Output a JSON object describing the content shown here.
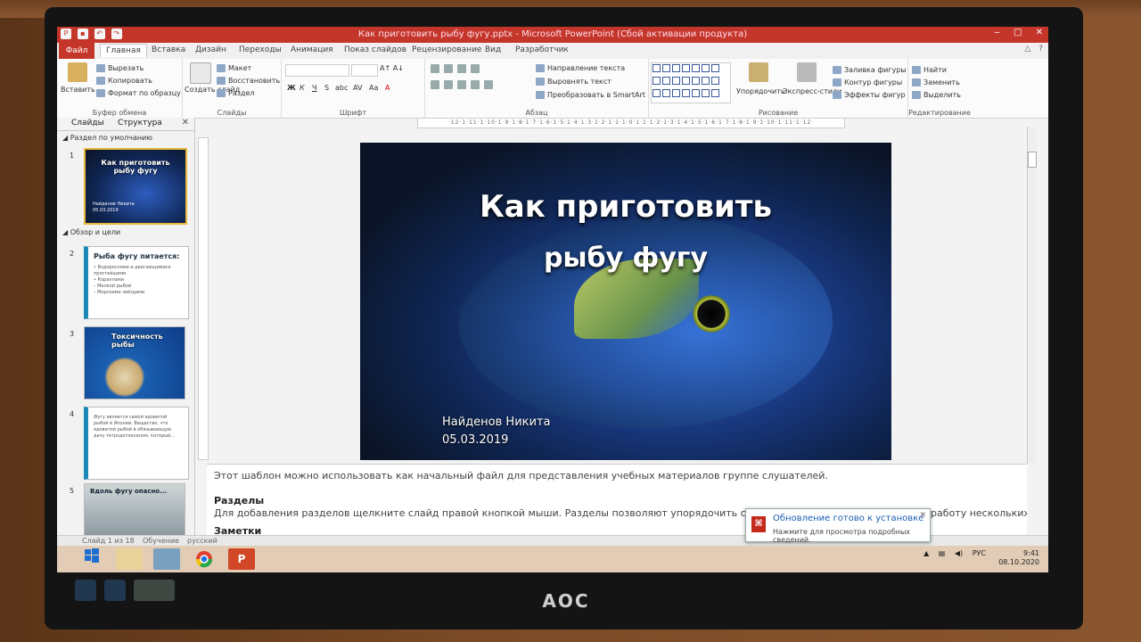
{
  "window": {
    "title": "Как приготовить рыбу фугу.pptx - Microsoft PowerPoint (Сбой активации продукта)",
    "controls": [
      "‒",
      "□",
      "✕"
    ]
  },
  "tabs": [
    "Файл",
    "Главная",
    "Вставка",
    "Дизайн",
    "Переходы",
    "Анимация",
    "Показ слайдов",
    "Рецензирование",
    "Вид",
    "Разработчик"
  ],
  "ribbon": {
    "clipboard": {
      "label": "Буфер обмена",
      "paste": "Вставить",
      "cut": "Вырезать",
      "copy": "Копировать",
      "format_painter": "Формат по образцу"
    },
    "slides": {
      "label": "Слайды",
      "new_slide": "Создать слайд",
      "layout": "Макет",
      "reset": "Восстановить",
      "section": "Раздел"
    },
    "font": {
      "label": "Шрифт",
      "bold": "Ж",
      "italic": "К",
      "underline": "Ч",
      "strike": "S",
      "shadow": "abc",
      "spacing": "AV",
      "case": "Aa",
      "color": "A"
    },
    "paragraph": {
      "label": "Абзац",
      "text_direction": "Направление текста",
      "align_text": "Выровнять текст",
      "smartart": "Преобразовать в SmartArt"
    },
    "drawing": {
      "label": "Рисование",
      "arrange": "Упорядочить",
      "quick_styles": "Экспресс-стили",
      "shape_fill": "Заливка фигуры",
      "shape_outline": "Контур фигуры",
      "shape_effects": "Эффекты фигур"
    },
    "editing": {
      "label": "Редактирование",
      "find": "Найти",
      "replace": "Заменить",
      "select": "Выделить"
    }
  },
  "left_panel": {
    "tabs": [
      "Слайды",
      "Структура"
    ],
    "sections": [
      "Раздел по умолчанию",
      "Обзор и цели"
    ],
    "slides": [
      {
        "num": "1",
        "title": "Как приготовить рыбу фугу",
        "sub": "Найденов Никита\n05.03.2019"
      },
      {
        "num": "2",
        "title": "Рыба фугу питается:",
        "sub": "• Водорослями и двигающимися простейшими\n• Кораллами\n– Мелкой рыбой\n– Морскими звёздами"
      },
      {
        "num": "3",
        "title": "Токсичность рыбы",
        "sub": ""
      },
      {
        "num": "4",
        "title": "",
        "sub": "Фугу является самой ядовитой рыбой в Японии. Вещество, что ядовитой рыбой в обязывающую дачу тетродотоксином, который..."
      },
      {
        "num": "5",
        "title": "Вдоль фугу опасно...",
        "sub": ""
      }
    ]
  },
  "ruler": "·12·1·11·1·10·1·9·1·8·1·7·1·6·1·5·1·4·1·3·1·2·1·1·1·0·1·1·1·2·1·3·1·4·1·5·1·6·1·7·1·8·1·9·1·10·1·11·1·12·",
  "slide": {
    "title_line1": "Как приготовить",
    "title_line2": "рыбу фугу",
    "author": "Найденов Никита",
    "date": "05.03.2019"
  },
  "notes": {
    "line1": "Этот шаблон можно использовать как начальный файл для представления учебных материалов группе слушателей.",
    "heading": "Разделы",
    "line2": "Для добавления разделов щелкните слайд правой кнопкой мыши. Разделы позволяют упорядочить слайды и организовать совместную работу нескольких авторов.",
    "heading2": "Заметки"
  },
  "status": {
    "slide": "Слайд 1 из 18",
    "theme": "Обучение",
    "lang": "русский"
  },
  "notification": {
    "title": "Обновление готово к установке",
    "subtitle": "Нажмите для просмотра подробных сведений."
  },
  "taskbar": {
    "lang": "РУС",
    "time": "9:41",
    "date": "08.10.2020"
  },
  "monitor": {
    "brand": "AOC"
  }
}
